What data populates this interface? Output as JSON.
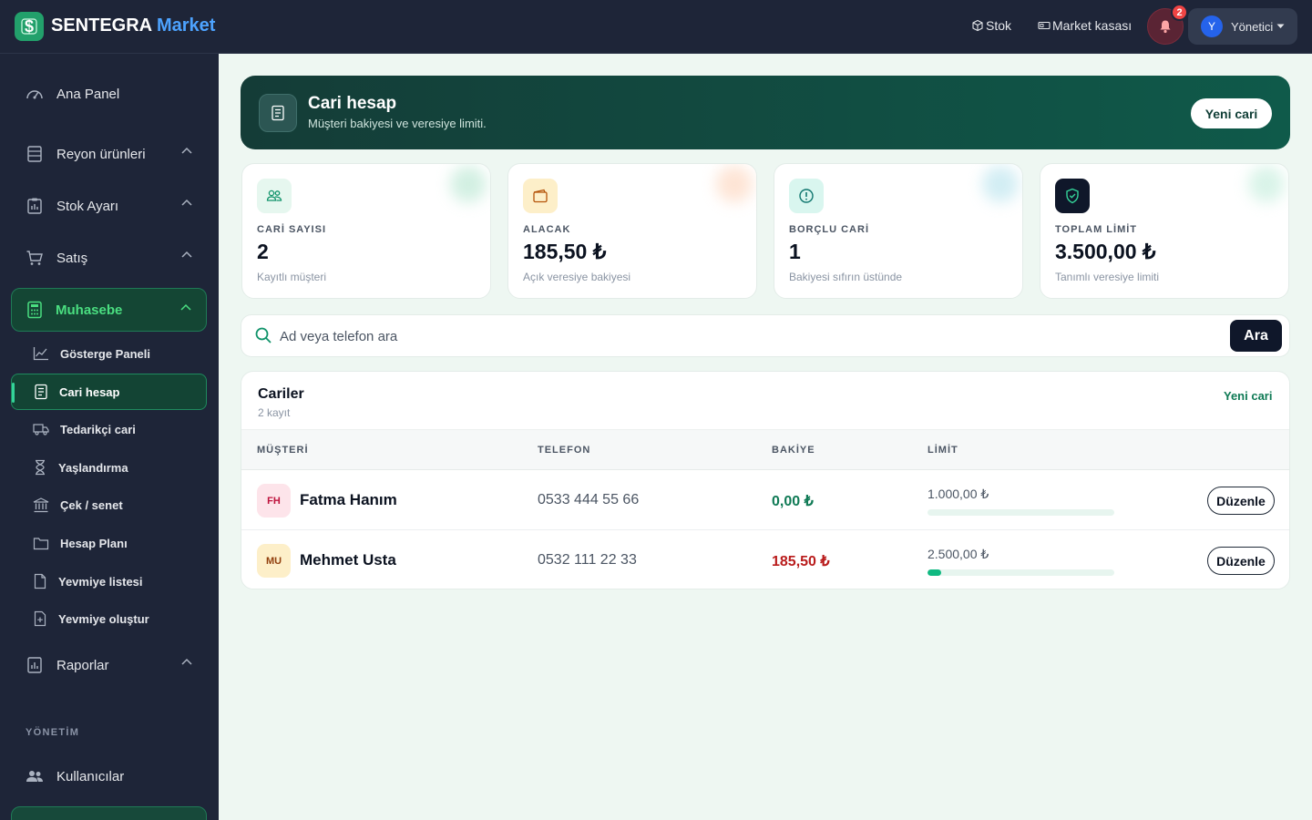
{
  "header": {
    "brand_main": "SENTEGRA",
    "brand_accent": "Market",
    "links": [
      {
        "label": "Stok",
        "icon": "box-icon"
      },
      {
        "label": "Market kasası",
        "icon": "cash-icon"
      }
    ],
    "notification_count": "2",
    "user_initial": "Y",
    "user_name": "Yönetici"
  },
  "sidebar": {
    "items": [
      {
        "label": "Ana Panel",
        "icon": "dashboard-gauge-icon"
      },
      {
        "label": "Reyon ürünleri",
        "icon": "shelf-icon"
      },
      {
        "label": "Stok Ayarı",
        "icon": "clipboard-icon"
      },
      {
        "label": "Satış",
        "icon": "cart-icon"
      },
      {
        "label": "Muhasebe",
        "icon": "calculator-icon"
      },
      {
        "label": "Raporlar",
        "icon": "report-icon"
      }
    ],
    "subitems": [
      {
        "label": "Gösterge Paneli",
        "icon": "line-chart-icon"
      },
      {
        "label": "Cari hesap",
        "icon": "ledger-icon"
      },
      {
        "label": "Tedarikçi cari",
        "icon": "truck-icon"
      },
      {
        "label": "Yaşlandırma",
        "icon": "hourglass-icon"
      },
      {
        "label": "Çek / senet",
        "icon": "bank-icon"
      },
      {
        "label": "Hesap Planı",
        "icon": "folder-icon"
      },
      {
        "label": "Yevmiye listesi",
        "icon": "document-icon"
      },
      {
        "label": "Yevmiye oluştur",
        "icon": "document-add-icon"
      }
    ],
    "section_label": "YÖNETİM",
    "users_label": "Kullanıcılar"
  },
  "banner": {
    "title": "Cari hesap",
    "subtitle": "Müşteri bakiyesi ve veresiye limiti.",
    "button": "Yeni cari"
  },
  "stats": [
    {
      "label": "CARİ SAYISI",
      "value": "2",
      "hint": "Kayıtlı müşteri",
      "icon": "users-icon",
      "color": "#e6f7ef"
    },
    {
      "label": "ALACAK",
      "value": "185,50 ₺",
      "hint": "Açık veresiye bakiyesi",
      "icon": "wallet-icon",
      "color": "#fdefc9"
    },
    {
      "label": "BORÇLU CARİ",
      "value": "1",
      "hint": "Bakiyesi sıfırın üstünde",
      "icon": "alert-circle-icon",
      "color": "#d9f6ef"
    },
    {
      "label": "TOPLAM LİMİT",
      "value": "3.500,00 ₺",
      "hint": "Tanımlı veresiye limiti",
      "icon": "shield-check-icon",
      "color": "#0f172a"
    }
  ],
  "search": {
    "placeholder": "Ad veya telefon ara",
    "value": "",
    "button": "Ara"
  },
  "table": {
    "title": "Cariler",
    "count": "2 kayıt",
    "new_link": "Yeni cari",
    "columns": [
      "MÜŞTERİ",
      "TELEFON",
      "BAKİYE",
      "LİMİT"
    ],
    "rows": [
      {
        "initials": "FH",
        "name": "Fatma Hanım",
        "phone": "0533 444 55 66",
        "balance": "0,00 ₺",
        "limit": "1.000,00 ₺",
        "limit_used_fraction": 0.0,
        "action": "Düzenle",
        "balance_color": "#0f7a55"
      },
      {
        "initials": "MU",
        "name": "Mehmet Usta",
        "phone": "0532 111 22 33",
        "balance": "185,50 ₺",
        "limit": "2.500,00 ₺",
        "limit_used_fraction": 0.0742,
        "action": "Düzenle",
        "balance_color": "#b91c1c"
      }
    ]
  }
}
